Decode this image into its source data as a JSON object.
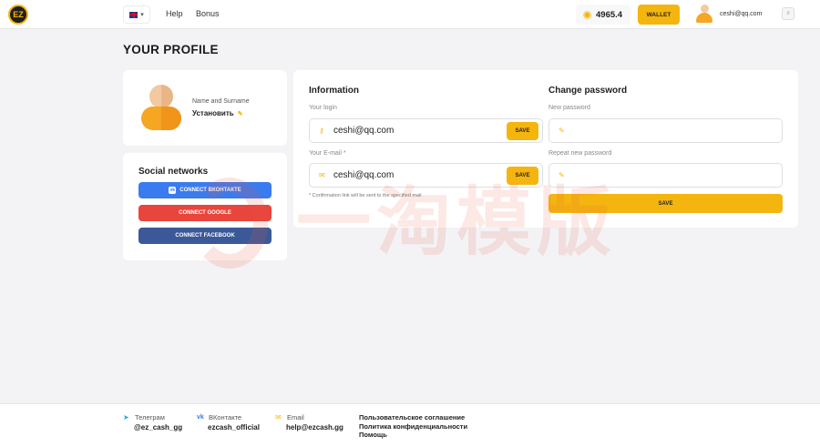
{
  "header": {
    "logo_text": "EZ",
    "nav": {
      "help": "Help",
      "bonus": "Bonus"
    },
    "balance": "4965.4",
    "wallet_label": "WALLET",
    "user_email": "ceshi@qq.com"
  },
  "page": {
    "title": "YOUR PROFILE"
  },
  "profile": {
    "name_label": "Name and Surname",
    "name_value": "Установить"
  },
  "social": {
    "title": "Social networks",
    "vk": "CONNECT ВКОНТАКТЕ",
    "google": "CONNECT GOOGLE",
    "facebook": "CONNECT FACEBOOK"
  },
  "information": {
    "title": "Information",
    "login_label": "Your login",
    "login_value": "ceshi@qq.com",
    "email_label": "Your E-mail *",
    "email_value": "ceshi@qq.com",
    "save": "SAVE",
    "note": "* Confirmation link will be sent to the specified mail"
  },
  "password": {
    "title": "Change password",
    "new_label": "New password",
    "repeat_label": "Repeat new password",
    "save": "SAVE"
  },
  "watermark": "一淘模版",
  "footer": {
    "telegram_label": "Телеграм",
    "telegram_value": "@ez_cash_gg",
    "vk_label": "ВКонтакте",
    "vk_value": "ezcash_official",
    "email_label": "Email",
    "email_value": "help@ezcash.gg",
    "links": [
      "Пользовательское соглашение",
      "Политика конфиденциальности",
      "Помощь"
    ]
  },
  "colors": {
    "accent": "#f5b50f",
    "vk": "#3a7bef",
    "google": "#e8453c",
    "facebook": "#3b5998"
  }
}
